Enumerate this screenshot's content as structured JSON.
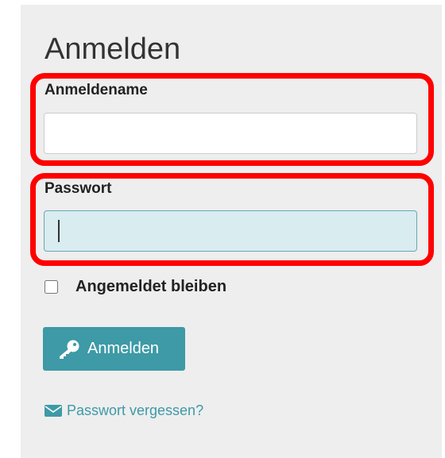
{
  "login": {
    "title": "Anmelden",
    "username_label": "Anmeldename",
    "username_value": "",
    "password_label": "Passwort",
    "password_value": "",
    "remember_label": "Angemeldet bleiben",
    "remember_checked": false,
    "submit_label": "Anmelden",
    "forgot_label": "Passwort vergessen?"
  },
  "icons": {
    "submit": "key-icon",
    "forgot": "envelope-icon"
  },
  "colors": {
    "accent": "#3d9aa6",
    "highlight": "#ff0000",
    "panel": "#eeeeee",
    "focused_input": "#d9ecef"
  }
}
